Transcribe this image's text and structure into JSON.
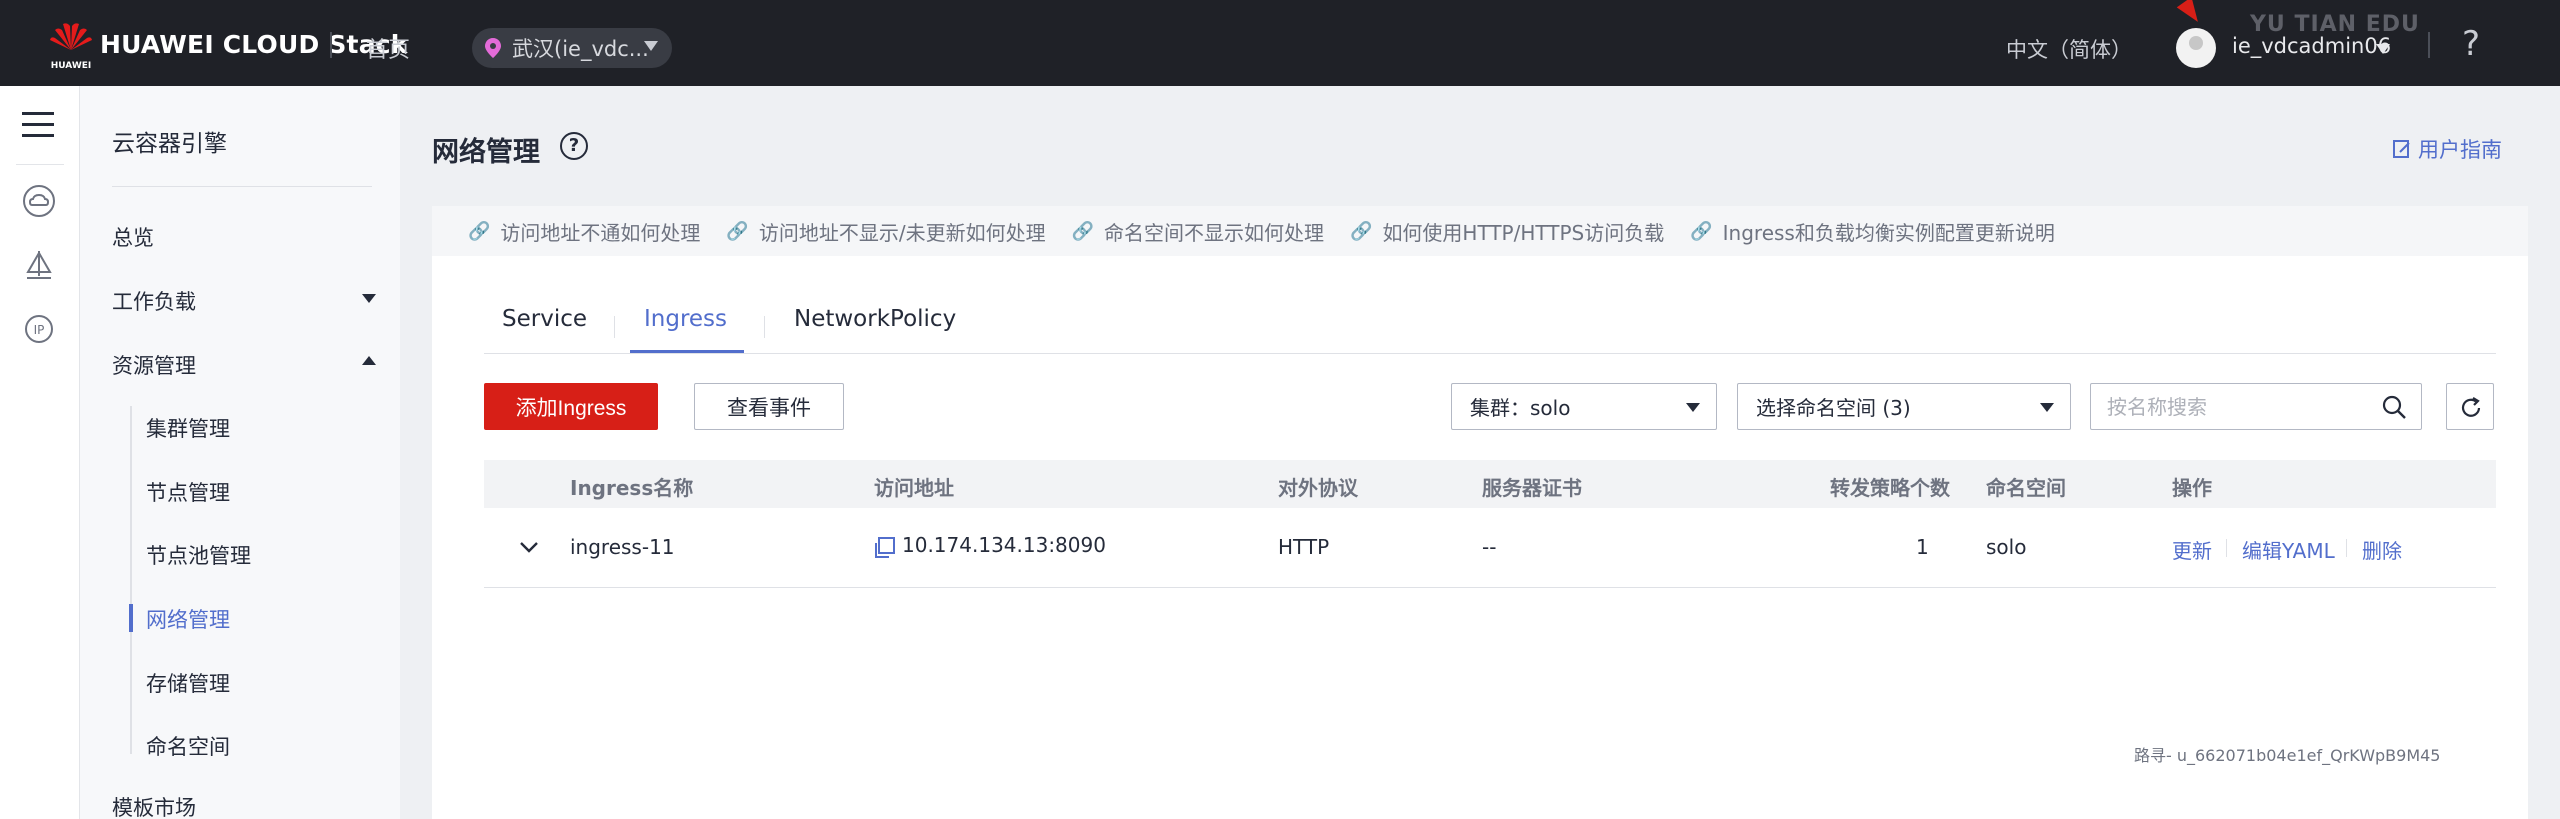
{
  "topbar": {
    "brand": "HUAWEI CLOUD Stack",
    "logo_text": "HUAWEI",
    "home": "首页",
    "region": "武汉(ie_vdc...",
    "language": "中文（简体）",
    "username": "ie_vdcadmin06",
    "help": "?",
    "watermark": "YU TIAN EDU"
  },
  "rail": {
    "icons": [
      "menu-icon",
      "cloud-icon",
      "sail-icon",
      "ip-icon"
    ]
  },
  "sidenav": {
    "title": "云容器引擎",
    "overview": "总览",
    "workload": "工作负载",
    "resource": "资源管理",
    "sub_items": [
      "集群管理",
      "节点管理",
      "节点池管理",
      "网络管理",
      "存储管理",
      "命名空间"
    ],
    "active_sub": "网络管理",
    "template_market": "模板市场"
  },
  "main": {
    "title": "网络管理",
    "user_guide": "用户指南",
    "faqs": [
      "访问地址不通如何处理",
      "访问地址不显示/未更新如何处理",
      "命名空间不显示如何处理",
      "如何使用HTTP/HTTPS访问负载",
      "Ingress和负载均衡实例配置更新说明"
    ],
    "tabs": [
      "Service",
      "Ingress",
      "NetworkPolicy"
    ],
    "active_tab": "Ingress",
    "add_button": "添加Ingress",
    "events_button": "查看事件",
    "cluster_select": "集群：solo",
    "namespace_select": "选择命名空间 (3)",
    "search_placeholder": "按名称搜索",
    "table": {
      "headers": [
        "Ingress名称",
        "访问地址",
        "对外协议",
        "服务器证书",
        "转发策略个数",
        "命名空间",
        "操作"
      ],
      "rows": [
        {
          "name": "ingress-11",
          "address": "10.174.134.13:8090",
          "protocol": "HTTP",
          "cert": "--",
          "rules": "1",
          "namespace": "solo",
          "ops": [
            "更新",
            "编辑YAML",
            "删除"
          ]
        }
      ]
    },
    "trace": "路寻- u_662071b04e1ef_QrKWpB9M45"
  },
  "colors": {
    "topbar_bg": "#1f2127",
    "primary_red": "#d71f17",
    "link_blue": "#526ecc"
  }
}
